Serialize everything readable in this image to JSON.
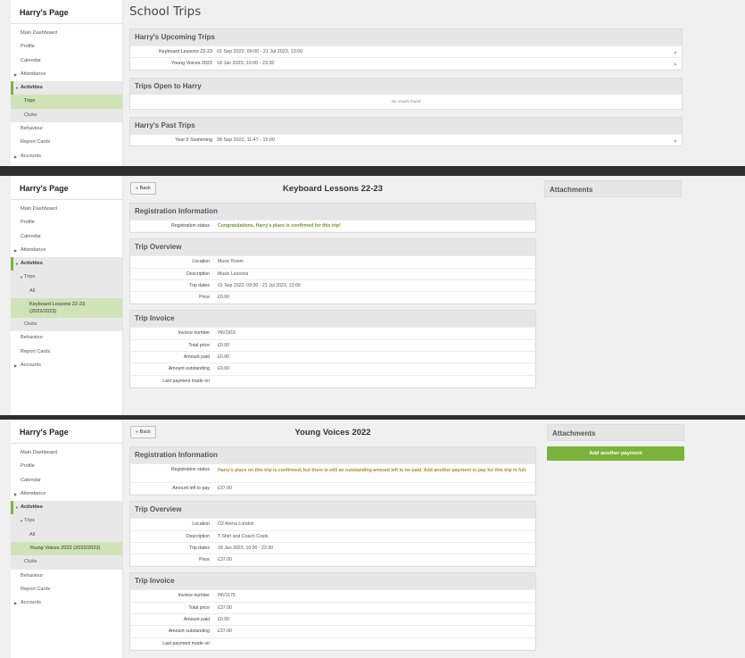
{
  "sidebar_title": "Harry's Page",
  "panel1": {
    "nav": [
      "Main Dashboard",
      "Profile",
      "Calendar",
      "Attendance",
      "Activities",
      "Trips",
      "Clubs",
      "Behaviour",
      "Report Cards",
      "Accounts"
    ],
    "page_title": "School Trips",
    "upcoming": {
      "heading": "Harry's Upcoming Trips",
      "rows": [
        {
          "name": "Keyboard Lessons 22-23",
          "dates": "01 Sep 2022, 09:00 - 21 Jul 2023, 13:00"
        },
        {
          "name": "Young Voices 2022",
          "dates": "18 Jan 2023, 10:00 - 23:30"
        }
      ]
    },
    "open": {
      "heading": "Trips Open to Harry",
      "empty": "No results found"
    },
    "past": {
      "heading": "Harry's Past Trips",
      "rows": [
        {
          "name": "Year 5 Swimming",
          "dates": "28 Sep 2022, 11:47 - 15:00"
        }
      ]
    }
  },
  "panel2": {
    "nav": [
      "Main Dashboard",
      "Profile",
      "Calendar",
      "Attendance",
      "Activities",
      "Trips",
      "All",
      "Keyboard Lessons 22-23",
      "(2022/2023)",
      "Clubs",
      "Behaviour",
      "Report Cards",
      "Accounts"
    ],
    "back": "« Back",
    "title": "Keyboard Lessons 22-23",
    "attachments": "Attachments",
    "reg": {
      "heading": "Registration Information",
      "status_label": "Registration status",
      "status": "Congratulations, Harry's place is confirmed for this trip!"
    },
    "overview": {
      "heading": "Trip Overview",
      "rows": [
        {
          "label": "Location",
          "value": "Music Room"
        },
        {
          "label": "Description",
          "value": "Music Lessons"
        },
        {
          "label": "Trip dates",
          "value": "01 Sep 2022, 09:00 - 21 Jul 2023, 13:00"
        },
        {
          "label": "Price",
          "value": "£0.00"
        }
      ]
    },
    "invoice": {
      "heading": "Trip Invoice",
      "rows": [
        {
          "label": "Invoice number",
          "value": "INV1915"
        },
        {
          "label": "Total price",
          "value": "£0.00"
        },
        {
          "label": "Amount paid",
          "value": "£0.00"
        },
        {
          "label": "Amount outstanding",
          "value": "£0.00"
        },
        {
          "label": "Last payment made on",
          "value": ""
        }
      ]
    }
  },
  "panel3": {
    "nav": [
      "Main Dashboard",
      "Profile",
      "Calendar",
      "Attendance",
      "Activities",
      "Trips",
      "All",
      "Young Voices 2022 (2022/2023)",
      "Clubs",
      "Behaviour",
      "Report Cards",
      "Accounts"
    ],
    "back": "« Back",
    "title": "Young Voices 2022",
    "attachments": "Attachments",
    "add_payment": "Add another payment",
    "reg": {
      "heading": "Registration Information",
      "status_label": "Registration status",
      "status": "Harry's place on this trip is confirmed, but there is still an outstanding amount left to be paid. Add another payment to pay for this trip in full.",
      "left_label": "Amount left to pay",
      "left": "£37.00"
    },
    "overview": {
      "heading": "Trip Overview",
      "rows": [
        {
          "label": "Location",
          "value": "O2 Arena London"
        },
        {
          "label": "Description",
          "value": "T-Shirt and Coach Costs"
        },
        {
          "label": "Trip dates",
          "value": "18 Jan 2023, 10:00 - 23:30"
        },
        {
          "label": "Price",
          "value": "£37.00"
        }
      ]
    },
    "invoice": {
      "heading": "Trip Invoice",
      "rows": [
        {
          "label": "Invoice number",
          "value": "INV1176"
        },
        {
          "label": "Total price",
          "value": "£37.00"
        },
        {
          "label": "Amount paid",
          "value": "£0.00"
        },
        {
          "label": "Amount outstanding",
          "value": "£37.00"
        },
        {
          "label": "Last payment made on",
          "value": ""
        }
      ]
    }
  },
  "colors": {
    "accent": "#7bb33a",
    "selected": "#cfe3b6",
    "ok_text": "#6a9a2a",
    "warn_text": "#b08a2a",
    "divider": "#2e2e2e"
  },
  "icons": {
    "row_arrow": "triangle-right-icon",
    "nav_caret": "caret-right-icon",
    "nav_open": "caret-down-icon"
  }
}
